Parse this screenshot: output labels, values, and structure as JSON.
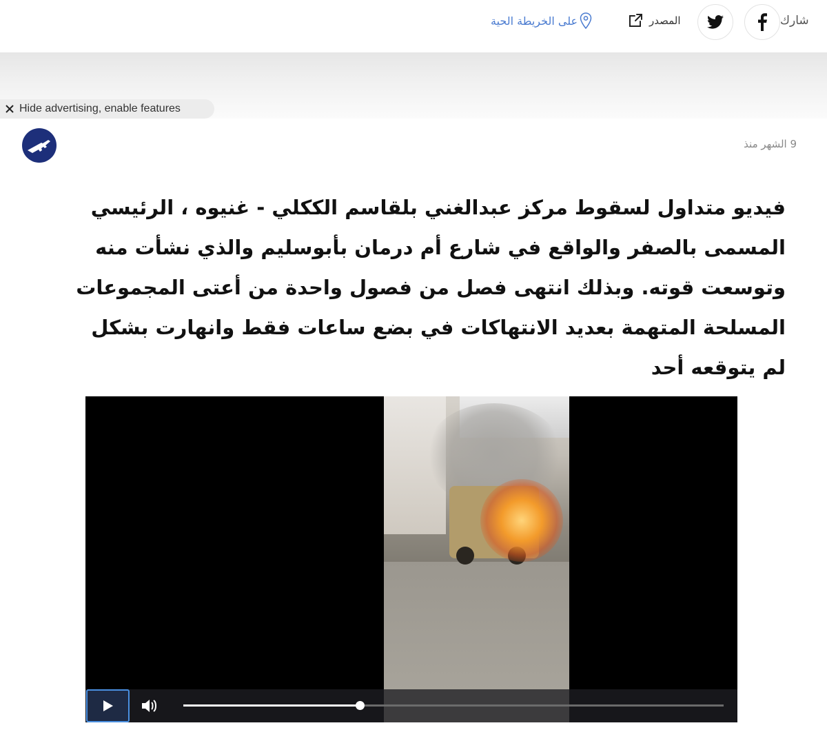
{
  "share": {
    "label": "شارك",
    "facebook_icon": "facebook-icon",
    "twitter_icon": "twitter-icon",
    "source_label": "المصدر",
    "map_label": "على الخريطة الحية"
  },
  "ad": {
    "hide_label": "Hide advertising, enable features"
  },
  "post": {
    "time_ago": "9 الشهر منذ",
    "headline": "فيديو متداول لسقوط مركز عبدالغني بلقاسم الككلي - غنيوه ، الرئيسي المسمى بالصفر والواقع في شارع أم درمان بأبوسليم والذي نشأت منه وتوسعت قوته. وبذلك انتهى فصل من فصول واحدة من أعتى المجموعات المسلحة المتهمة بعديد الانتهاكات في بضع ساعات فقط وانهارت بشكل لم يتوقعه أحد"
  },
  "video": {
    "progress": 0.326,
    "colors": {
      "accent": "#4a90e2",
      "control_bg": "#1e1e23"
    }
  }
}
